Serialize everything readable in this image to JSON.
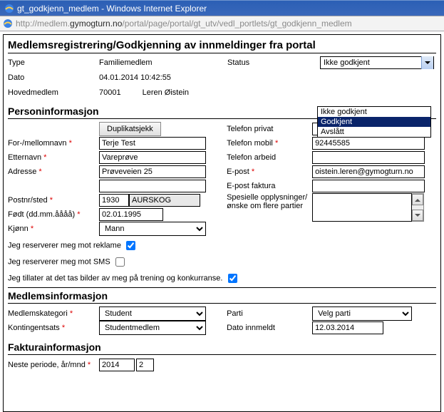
{
  "window": {
    "title": "gt_godkjenn_medlem - Windows Internet Explorer"
  },
  "url": {
    "pre": "http://medlem.",
    "dom": "gymogturn.no",
    "post": "/portal/page/portal/gt_utv/vedl_portlets/gt_godkjenn_medlem"
  },
  "header": {
    "title": "Medlemsregistrering/Godkjenning av innmeldinger fra portal",
    "type_lbl": "Type",
    "type_val": "Familiemedlem",
    "dato_lbl": "Dato",
    "dato_val": "04.01.2014 10:42:55",
    "hoved_lbl": "Hovedmedlem",
    "hoved_id": "70001",
    "hoved_name": "Leren Øistein",
    "status_lbl": "Status",
    "status_val": "Ikke godkjent",
    "status_options": {
      "o0": "Ikke godkjent",
      "o1": "Godkjent",
      "o2": "Avslått"
    }
  },
  "person": {
    "title": "Personinformasjon",
    "dup_btn": "Duplikatsjekk",
    "fornavn_lbl": "For-/mellomnavn",
    "fornavn_val": "Terje Test",
    "etternavn_lbl": "Etternavn",
    "etternavn_val": "Vareprøve",
    "adresse_lbl": "Adresse",
    "adresse_val": "Prøveveien 25",
    "postnr_lbl": "Postnr/sted",
    "postnr_val": "1930",
    "poststed_val": "AURSKOG",
    "fodt_lbl": "Født (dd.mm.åååå)",
    "fodt_val": "02.01.1995",
    "kjonn_lbl": "Kjønn",
    "kjonn_val": "Mann",
    "tel_priv_lbl": "Telefon privat",
    "tel_priv_val": "",
    "tel_mob_lbl": "Telefon mobil",
    "tel_mob_val": "92445585",
    "tel_arb_lbl": "Telefon arbeid",
    "tel_arb_val": "",
    "epost_lbl": "E-post",
    "epost_val": "oistein.leren@gymogturn.no",
    "epost_fakt_lbl": "E-post faktura",
    "epost_fakt_val": "",
    "spes_lbl1": "Spesielle opplysninger/",
    "spes_lbl2": "ønske om flere partier",
    "spes_val": ""
  },
  "checks": {
    "reklame": "Jeg reserverer meg mot reklame",
    "sms": "Jeg reserverer meg mot SMS",
    "bilder": "Jeg tillater at det tas bilder av meg på trening og konkurranse."
  },
  "medlem": {
    "title": "Medlemsinformasjon",
    "kat_lbl": "Medlemskategori",
    "kat_val": "Student",
    "sats_lbl": "Kontingentsats",
    "sats_val": "Studentmedlem",
    "parti_lbl": "Parti",
    "parti_val": "Velg parti",
    "dato_inn_lbl": "Dato innmeldt",
    "dato_inn_val": "12.03.2014"
  },
  "faktura": {
    "title": "Fakturainformasjon",
    "periode_lbl": "Neste periode, år/mnd",
    "aar": "2014",
    "mnd": "2"
  }
}
